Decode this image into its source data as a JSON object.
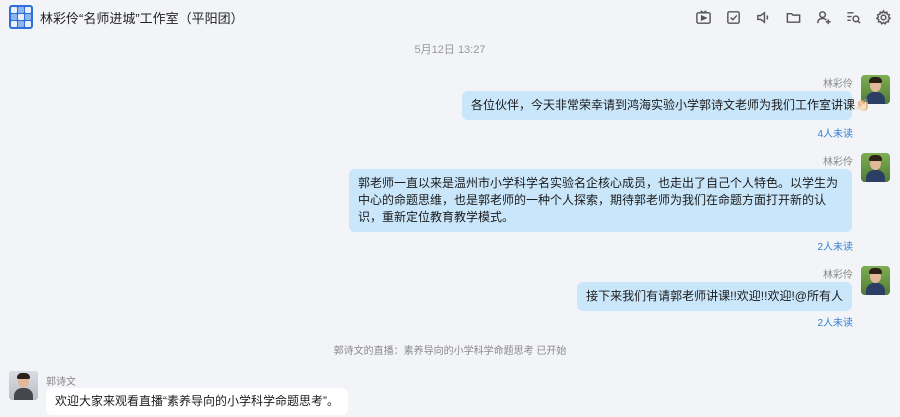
{
  "header": {
    "title": "林彩伶“名师进城”工作室（平阳团）",
    "toolbar": [
      {
        "name": "video-icon"
      },
      {
        "name": "task-check-icon"
      },
      {
        "name": "speaker-icon"
      },
      {
        "name": "folder-icon"
      },
      {
        "name": "add-member-icon"
      },
      {
        "name": "search-chat-icon"
      },
      {
        "name": "settings-gear-icon"
      }
    ]
  },
  "chat": {
    "timestamp": "5月12日 13:27",
    "messages": [
      {
        "sender": "林彩伶",
        "text": "各位伙伴，今天非常荣幸请到鸿海实验小学郭诗文老师为我们工作室讲课👏🏻",
        "read": "4人未读"
      },
      {
        "sender": "林彩伶",
        "text": "郭老师一直以来是温州市小学科学名实验名企核心成员，也走出了自己个人特色。以学生为中心的命题思维，也是郭老师的一种个人探索，期待郭老师为我们在命题方面打开新的认识，重新定位教育教学模式。",
        "read": "2人未读"
      },
      {
        "sender": "林彩伶",
        "text": "接下来我们有请郭老师讲课!!欢迎!!欢迎!@所有人",
        "read": "2人未读"
      }
    ],
    "system_notice": {
      "prefix": "郭诗文的直播：",
      "topic": "素养导向的小学科学命题思考",
      "status": "已开始"
    },
    "incoming": {
      "sender": "郭诗文",
      "text": "欢迎大家来观看直播“素养导向的小学科学命题思考”。"
    }
  }
}
